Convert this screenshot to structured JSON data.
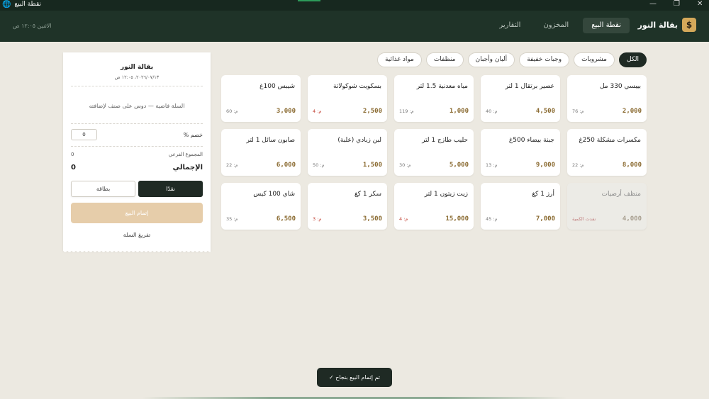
{
  "window": {
    "title": "نقطة البيع",
    "globe_icon": "globe-icon",
    "minimize": "—",
    "maximize": "❐",
    "close": "✕"
  },
  "header": {
    "logo_symbol": "$",
    "shop_name": "بقالة النور",
    "nav": [
      {
        "label": "نقطة البيع",
        "active": true
      },
      {
        "label": "المخزون",
        "active": false
      },
      {
        "label": "التقارير",
        "active": false
      }
    ],
    "date_text": "الاثنين ١٢:٠٥ ص"
  },
  "filters": [
    {
      "label": "الكل",
      "active": true
    },
    {
      "label": "مشروبات",
      "active": false
    },
    {
      "label": "وجبات خفيفة",
      "active": false
    },
    {
      "label": "ألبان وأجبان",
      "active": false
    },
    {
      "label": "منظفات",
      "active": false
    },
    {
      "label": "مواد غذائية",
      "active": false
    }
  ],
  "products": [
    {
      "name": "بيبسي 330 مل",
      "price": "2,000",
      "stock": "م: 76",
      "stock_low": false,
      "out": false
    },
    {
      "name": "عصير برتقال 1 لتر",
      "price": "4,500",
      "stock": "م: 40",
      "stock_low": false,
      "out": false
    },
    {
      "name": "مياه معدنية 1.5 لتر",
      "price": "1,000",
      "stock": "م: 119",
      "stock_low": false,
      "out": false
    },
    {
      "name": "بسكويت شوكولاتة",
      "price": "2,500",
      "stock": "م: 4",
      "stock_low": true,
      "out": false
    },
    {
      "name": "شيبس 100غ",
      "price": "3,000",
      "stock": "م: 60",
      "stock_low": false,
      "out": false
    },
    {
      "name": "مكسرات مشكلة 250غ",
      "price": "8,000",
      "stock": "م: 22",
      "stock_low": false,
      "out": false
    },
    {
      "name": "جبنة بيضاء 500غ",
      "price": "9,000",
      "stock": "م: 13",
      "stock_low": false,
      "out": false
    },
    {
      "name": "حليب طازج 1 لتر",
      "price": "5,000",
      "stock": "م: 30",
      "stock_low": false,
      "out": false
    },
    {
      "name": "لبن زبادي (علبة)",
      "price": "1,500",
      "stock": "م: 50",
      "stock_low": false,
      "out": false
    },
    {
      "name": "صابون سائل 1 لتر",
      "price": "6,000",
      "stock": "م: 22",
      "stock_low": false,
      "out": false
    },
    {
      "name": "منظف أرضيات",
      "price": "4,000",
      "stock": "نفدت الكمية",
      "stock_low": true,
      "out": true
    },
    {
      "name": "أرز 1 كغ",
      "price": "7,000",
      "stock": "م: 45",
      "stock_low": false,
      "out": false
    },
    {
      "name": "زيت زيتون 1 لتر",
      "price": "15,000",
      "stock": "م: 4",
      "stock_low": true,
      "out": false
    },
    {
      "name": "سكر 1 كغ",
      "price": "3,500",
      "stock": "م: 3",
      "stock_low": true,
      "out": false
    },
    {
      "name": "شاي 100 كيس",
      "price": "6,500",
      "stock": "م: 35",
      "stock_low": false,
      "out": false
    }
  ],
  "receipt": {
    "shop_name": "بقالة النور",
    "date": "٢٠٢٦/٠٧/١٣، ١٢:٠٥ ص",
    "empty_message": "السلة فاضية — دوس على صنف لإضافته",
    "discount_label": "خصم %",
    "discount_value": "0",
    "subtotal_label": "المجموع الفرعي",
    "subtotal_value": "0",
    "total_label": "الإجمالي",
    "total_value": "0",
    "pay_cash": "نقدًا",
    "pay_card": "بطاقة",
    "complete_button": "إتمام البيع",
    "clear_button": "تفريغ السلة"
  },
  "toast": "تم إتمام البيع بنجاح ✓",
  "colors": {
    "header_bg": "#1f3328",
    "accent_gold": "#d4a85a",
    "price": "#8a6a30",
    "low_stock": "#c0392b"
  }
}
